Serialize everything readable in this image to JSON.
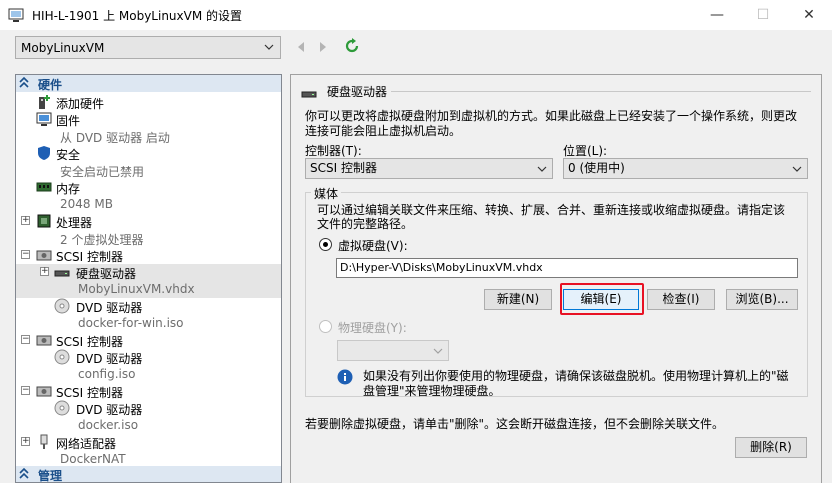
{
  "window": {
    "title": "HIH-L-1901 上 MobyLinuxVM 的设置",
    "minimize_glyph": "—",
    "maximize_glyph": "☐",
    "close_glyph": "✕"
  },
  "vm_selector": {
    "value": "MobyLinuxVM"
  },
  "tree": {
    "hardware_header": "硬件",
    "add_hardware": "添加硬件",
    "firmware": "固件",
    "firmware_sub": "从 DVD 驱动器 启动",
    "security": "安全",
    "security_sub": "安全启动已禁用",
    "memory": "内存",
    "memory_sub": "2048 MB",
    "processor": "处理器",
    "processor_sub": "2 个虚拟处理器",
    "scsi1": "SCSI 控制器",
    "hard_drive": "硬盘驱动器",
    "hard_drive_sub": "MobyLinuxVM.vhdx",
    "dvd1": "DVD 驱动器",
    "dvd1_sub": "docker-for-win.iso",
    "scsi2": "SCSI 控制器",
    "dvd2": "DVD 驱动器",
    "dvd2_sub": "config.iso",
    "scsi3": "SCSI 控制器",
    "dvd3": "DVD 驱动器",
    "dvd3_sub": "docker.iso",
    "network": "网络适配器",
    "network_sub": "DockerNAT",
    "management_header": "管理"
  },
  "panel": {
    "heading": "硬盘驱动器",
    "description_line1": "你可以更改将虚拟硬盘附加到虚拟机的方式。如果此磁盘上已经安装了一个操作系统，则更改",
    "description_line2": "连接可能会阻止虚拟机启动。",
    "controller_label": "控制器(T):",
    "controller_value": "SCSI 控制器",
    "location_label": "位置(L):",
    "location_value": "0 (使用中)",
    "media_label": "媒体",
    "media_desc_line1": "可以通过编辑关联文件来压缩、转换、扩展、合并、重新连接或收缩虚拟硬盘。请指定该",
    "media_desc_line2": "文件的完整路径。",
    "virtual_disk_label": "虚拟硬盘(V):",
    "virtual_disk_path": "D:\\Hyper-V\\Disks\\MobyLinuxVM.vhdx",
    "new_btn": "新建(N)",
    "edit_btn": "编辑(E)",
    "inspect_btn": "检查(I)",
    "browse_btn": "浏览(B)...",
    "physical_disk_label": "物理硬盘(Y):",
    "info_line1": "如果没有列出你要使用的物理硬盘，请确保该磁盘脱机。使用物理计算机上的\"磁",
    "info_line2": "盘管理\"来管理物理硬盘。",
    "remove_desc": "若要删除虚拟硬盘，请单击\"删除\"。这会断开磁盘连接，但不会删除关联文件。",
    "remove_btn": "删除(R)"
  },
  "colors": {
    "highlight_red": "#e81123",
    "section_bg": "#dde7f2",
    "info_blue": "#1e5fb4"
  }
}
